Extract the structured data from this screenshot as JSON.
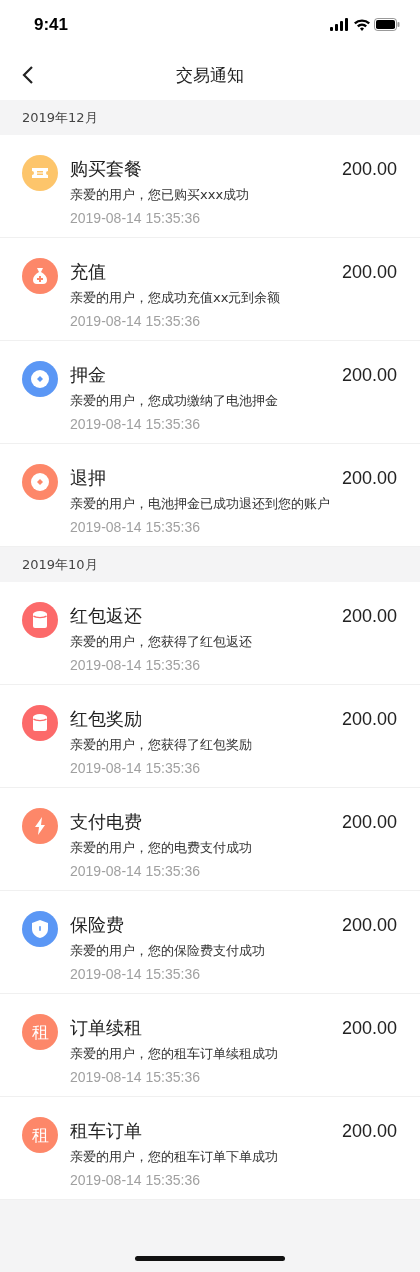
{
  "status_bar": {
    "time": "9:41"
  },
  "nav": {
    "title": "交易通知"
  },
  "sections": [
    {
      "header": "2019年12月",
      "items": [
        {
          "kind": "ticket",
          "color": "#fdc56b",
          "title": "购买套餐",
          "amount": "200.00",
          "desc": "亲爱的用户，您已购买xxx成功",
          "time": "2019-08-14 15:35:36"
        },
        {
          "kind": "bag",
          "color": "#fd8769",
          "title": "充值",
          "amount": "200.00",
          "desc": "亲爱的用户，您成功充值xx元到余额",
          "time": "2019-08-14 15:35:36"
        },
        {
          "kind": "coin",
          "color": "#5b97f5",
          "title": "押金",
          "amount": "200.00",
          "desc": "亲爱的用户，您成功缴纳了电池押金",
          "time": "2019-08-14 15:35:36"
        },
        {
          "kind": "coin",
          "color": "#fd8769",
          "title": "退押",
          "amount": "200.00",
          "desc": "亲爱的用户，电池押金已成功退还到您的账户",
          "time": "2019-08-14 15:35:36"
        }
      ]
    },
    {
      "header": "2019年10月",
      "items": [
        {
          "kind": "cylinder",
          "color": "#fc6a6a",
          "title": "红包返还",
          "amount": "200.00",
          "desc": "亲爱的用户，您获得了红包返还",
          "time": "2019-08-14 15:35:36"
        },
        {
          "kind": "cylinder",
          "color": "#fc6a6a",
          "title": "红包奖励",
          "amount": "200.00",
          "desc": "亲爱的用户，您获得了红包奖励",
          "time": "2019-08-14 15:35:36"
        },
        {
          "kind": "bolt",
          "color": "#fd8769",
          "title": "支付电费",
          "amount": "200.00",
          "desc": "亲爱的用户，您的电费支付成功",
          "time": "2019-08-14 15:35:36"
        },
        {
          "kind": "shield",
          "color": "#5b97f5",
          "title": "保险费",
          "amount": "200.00",
          "desc": "亲爱的用户，您的保险费支付成功",
          "time": "2019-08-14 15:35:36"
        },
        {
          "kind": "text",
          "glyph": "租",
          "color": "#fd8769",
          "title": "订单续租",
          "amount": "200.00",
          "desc": "亲爱的用户，您的租车订单续租成功",
          "time": "2019-08-14 15:35:36"
        },
        {
          "kind": "text",
          "glyph": "租",
          "color": "#fd8769",
          "title": "租车订单",
          "amount": "200.00",
          "desc": "亲爱的用户，您的租车订单下单成功",
          "time": "2019-08-14 15:35:36"
        }
      ]
    }
  ]
}
